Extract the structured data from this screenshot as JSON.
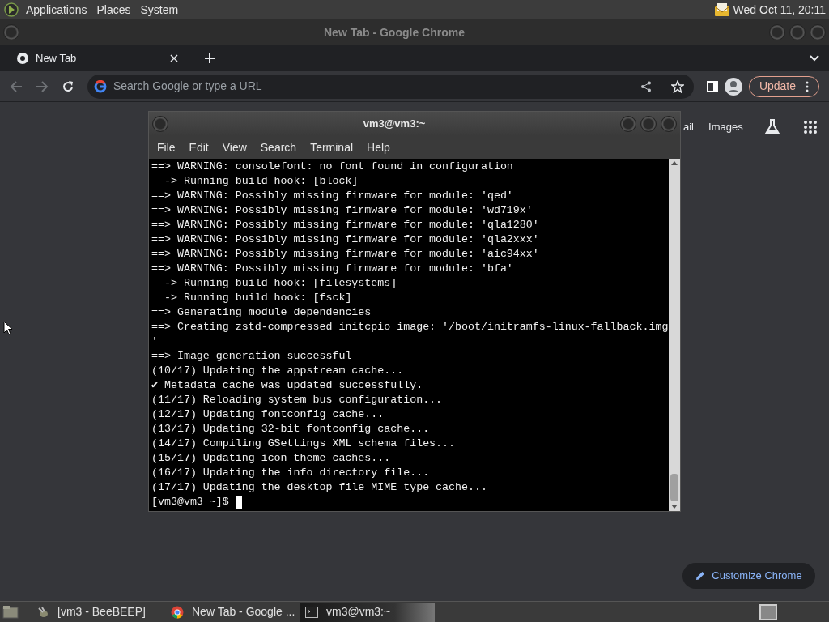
{
  "top_panel": {
    "menus": [
      "Applications",
      "Places",
      "System"
    ],
    "clock": "Wed Oct 11, 20:11"
  },
  "chrome": {
    "title": "New Tab - Google Chrome",
    "tabs": [
      {
        "label": "New Tab",
        "selected": true
      }
    ],
    "omnibox": {
      "placeholder": "Search Google or type a URL"
    },
    "update_button": "Update",
    "ntp_links": [
      "ail",
      "Images"
    ],
    "customize_button": "Customize Chrome"
  },
  "terminal": {
    "title": "vm3@vm3:~",
    "menus": [
      "File",
      "Edit",
      "View",
      "Search",
      "Terminal",
      "Help"
    ],
    "lines": [
      "==> WARNING: consolefont: no font found in configuration",
      "  -> Running build hook: [block]",
      "==> WARNING: Possibly missing firmware for module: 'qed'",
      "==> WARNING: Possibly missing firmware for module: 'wd719x'",
      "==> WARNING: Possibly missing firmware for module: 'qla1280'",
      "==> WARNING: Possibly missing firmware for module: 'qla2xxx'",
      "==> WARNING: Possibly missing firmware for module: 'aic94xx'",
      "==> WARNING: Possibly missing firmware for module: 'bfa'",
      "  -> Running build hook: [filesystems]",
      "  -> Running build hook: [fsck]",
      "==> Generating module dependencies",
      "==> Creating zstd-compressed initcpio image: '/boot/initramfs-linux-fallback.img",
      "'",
      "==> Image generation successful",
      "(10/17) Updating the appstream cache...",
      "✔ Metadata cache was updated successfully.",
      "(11/17) Reloading system bus configuration...",
      "(12/17) Updating fontconfig cache...",
      "(13/17) Updating 32-bit fontconfig cache...",
      "(14/17) Compiling GSettings XML schema files...",
      "(15/17) Updating icon theme caches...",
      "(16/17) Updating the info directory file...",
      "(17/17) Updating the desktop file MIME type cache..."
    ],
    "prompt": "[vm3@vm3 ~]$"
  },
  "taskbar": {
    "items": [
      {
        "label": "[vm3 - BeeBEEP]",
        "kind": "bee",
        "selected": false
      },
      {
        "label": "New Tab - Google ...",
        "kind": "chrome",
        "selected": false
      },
      {
        "label": "vm3@vm3:~",
        "kind": "terminal",
        "selected": true
      }
    ]
  }
}
